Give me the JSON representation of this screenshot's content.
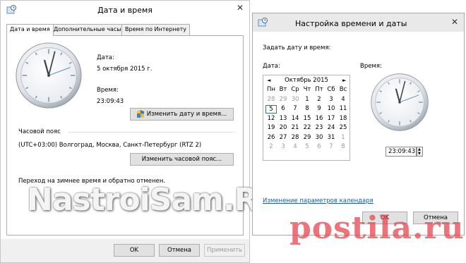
{
  "left_window": {
    "title": "Дата и время",
    "close_glyph": "✕",
    "tabs": [
      {
        "label": "Дата и время"
      },
      {
        "label": "Дополнительные часы"
      },
      {
        "label": "Время по Интернету"
      }
    ],
    "date_label": "Дата:",
    "date_value": "5 октября 2015 г.",
    "time_label": "Время:",
    "time_value": "23:09:43",
    "change_datetime_button": "Изменить дату и время...",
    "timezone_header": "Часовой пояс",
    "timezone_value": "(UTC+03:00) Волгоград, Москва, Санкт-Петербург (RTZ 2)",
    "change_timezone_button": "Изменить часовой пояс...",
    "dst_note": "Переход на зимнее время и обратно отменен.",
    "ok_button": "OK",
    "cancel_button": "Отмена",
    "apply_button": "Применить"
  },
  "watermark_left": "NastroiSam.RU",
  "right_window": {
    "title": "Настройка времени и даты",
    "close_glyph": "✕",
    "instruction": "Задать дату и время:",
    "date_label": "Дата:",
    "time_label": "Время:",
    "calendar": {
      "month": "Октябрь 2015",
      "prev": "◄",
      "next": "►",
      "weekdays": [
        "Пн",
        "Вт",
        "Ср",
        "Чт",
        "Пт",
        "Сб",
        "Вс"
      ],
      "weeks": [
        [
          "28",
          "29",
          "30",
          "1",
          "2",
          "3",
          "4"
        ],
        [
          "5",
          "6",
          "7",
          "8",
          "9",
          "10",
          "11"
        ],
        [
          "12",
          "13",
          "14",
          "15",
          "16",
          "17",
          "18"
        ],
        [
          "19",
          "20",
          "21",
          "22",
          "23",
          "24",
          "25"
        ],
        [
          "26",
          "27",
          "28",
          "29",
          "30",
          "31",
          "1"
        ],
        [
          "2",
          "3",
          "4",
          "5",
          "6",
          "7",
          "8"
        ]
      ],
      "selected": "5"
    },
    "time_value": "23:09:43",
    "spin_up": "▲",
    "spin_down": "▼",
    "calendar_settings_link": "Изменение параметров календаря",
    "ok_button": "OK",
    "cancel_button": "Отмена"
  },
  "watermark_right": "postila.ru",
  "colors": {
    "accent": "#1a5aa6",
    "button_bg": "#e1e1e1",
    "bar_bg": "#f0f0f0"
  }
}
